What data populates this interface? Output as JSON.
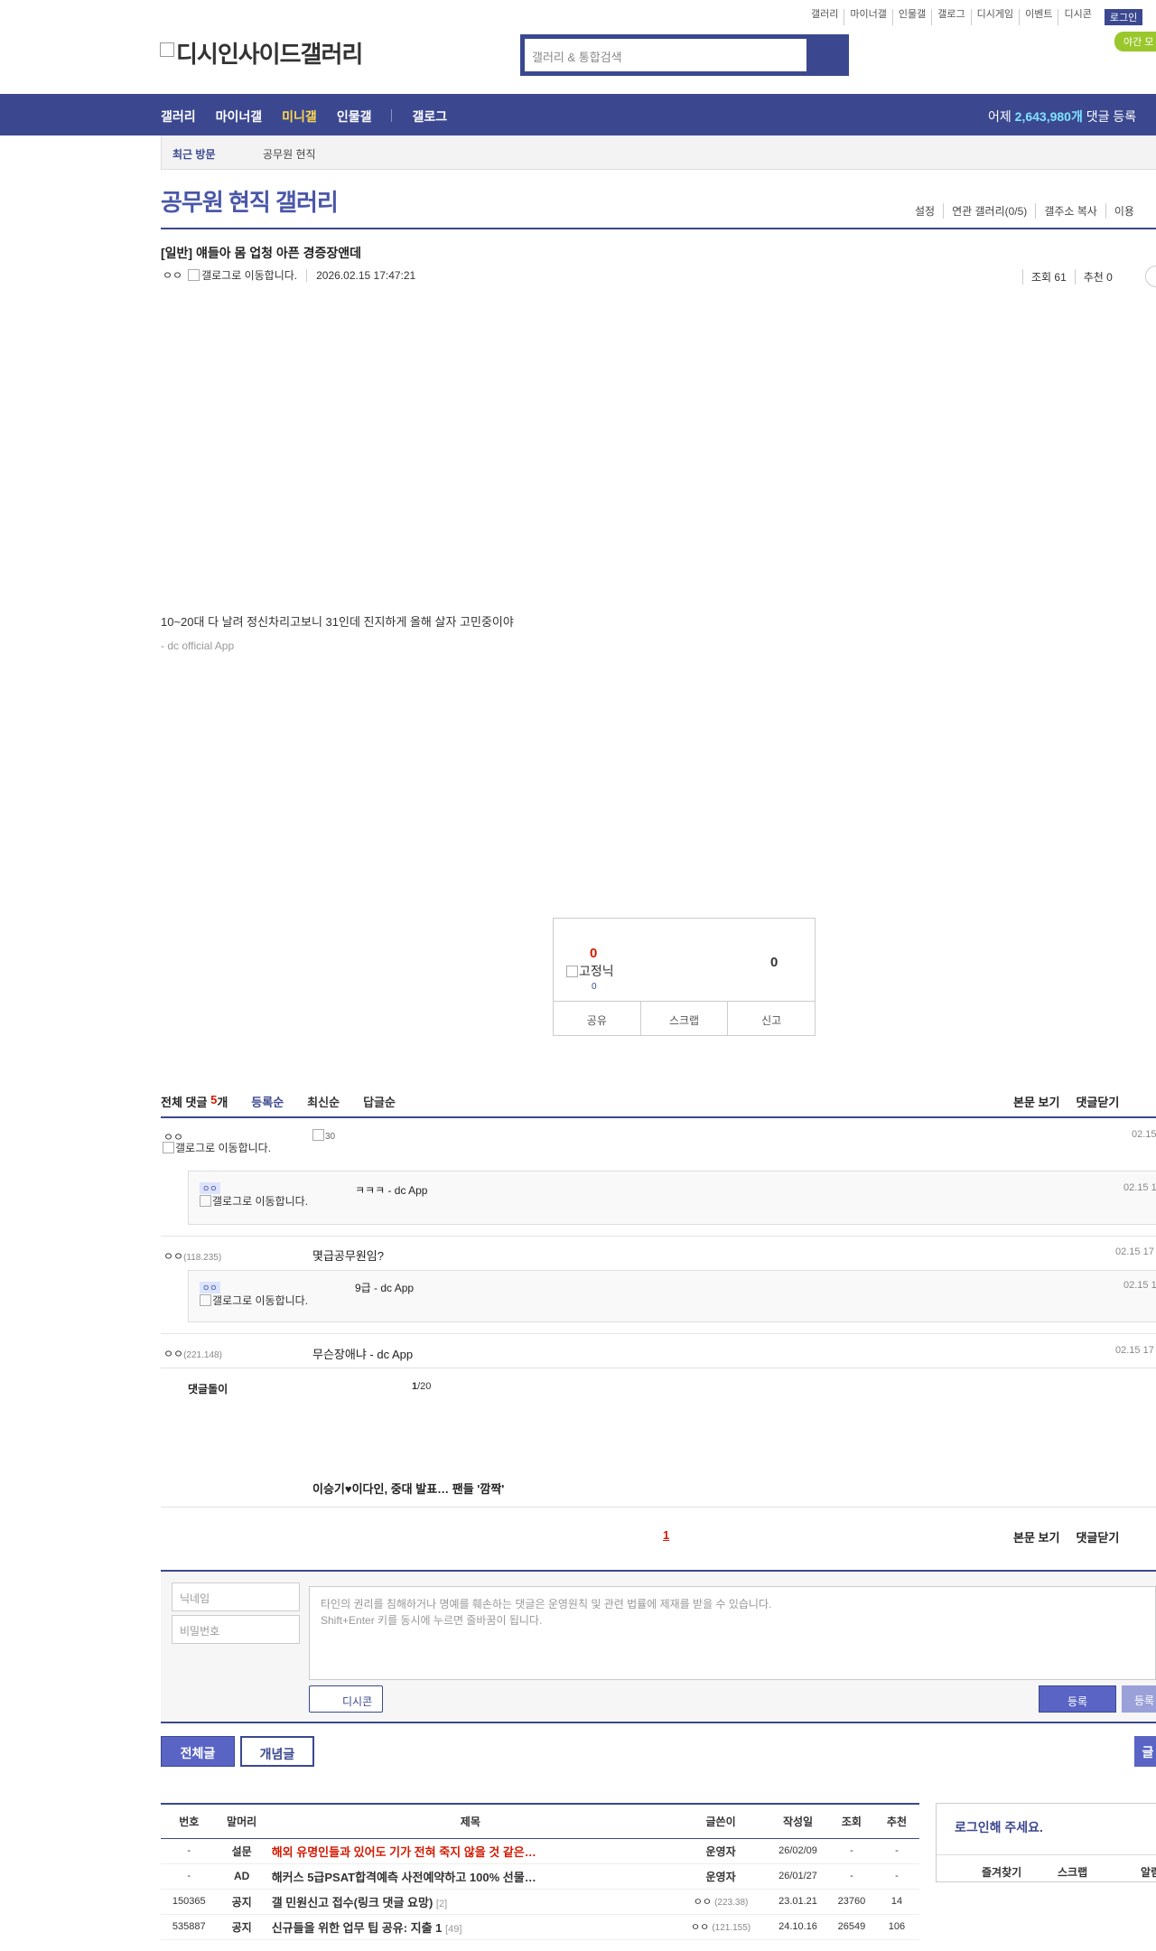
{
  "util_menu": [
    "갤러리",
    "마이너갤",
    "인물갤",
    "갤로그",
    "디시게임",
    "이벤트",
    "디시콘"
  ],
  "login_label": "로그인",
  "night_mode_label": "야간 모",
  "logo_text": "디시인사이드갤러리",
  "search": {
    "placeholder": "갤러리 & 통합검색"
  },
  "gnb": {
    "items": [
      "갤러리",
      "마이너갤",
      "미니갤",
      "인물갤",
      "갤로그"
    ],
    "stat_prefix": "어제",
    "stat_value": "2,643,980개",
    "stat_suffix": "댓글 등록"
  },
  "recent": {
    "label": "최근 방문",
    "gallery": "공무원 현직"
  },
  "gallery": {
    "title": "공무원 현직 갤러리",
    "options": [
      "설정",
      "연관 갤러리(0/5)",
      "갤주소 복사",
      "이용"
    ]
  },
  "post": {
    "title": "[일반] 얘들아 몸 업청 아픈 경증장앤데",
    "author": "ㅇㅇ",
    "author_img_alt": "갤로그로 이동합니다.",
    "date": "2026.02.15 17:47:21",
    "views": "조회 61",
    "recommends": "추천 0",
    "body": "10~20대 다 날려 정신차리고보니 31인데 진지하게 올해 살자 고민중이야",
    "app": "- dc official App"
  },
  "vote": {
    "up": "0",
    "fixed_label": "고정닉",
    "fixed_count": "0",
    "down": "0",
    "buttons": [
      "공유",
      "스크랩",
      "신고"
    ]
  },
  "comments_header": {
    "label": "전체 댓글",
    "count": "5",
    "unit": "개",
    "sorts": [
      "등록순",
      "최신순",
      "답글순"
    ],
    "right": [
      "본문 보기",
      "댓글닫기"
    ]
  },
  "comments": [
    {
      "nick": "ㅇㅇ",
      "img_alt": "갤로그로 이동합니다.",
      "img_text": "30",
      "date": "02.15"
    },
    {
      "nick": "ㅇㅇ",
      "img_alt": "갤로그로 이동합니다.",
      "text": "ㅋㅋㅋ - dc App",
      "date": "02.15 1"
    },
    {
      "nick": "ㅇㅇ",
      "ip": "(118.235)",
      "text": "몇급공무원임?",
      "date": "02.15 17"
    },
    {
      "nick": "ㅇㅇ",
      "img_alt": "갤로그로 이동합니다.",
      "text": "9급 - dc App",
      "date": "02.15 1"
    },
    {
      "nick": "ㅇㅇ",
      "ip": "(221.148)",
      "text": "무슨장애냐 - dc App",
      "date": "02.15 17"
    }
  ],
  "cmt_bot": {
    "label": "댓글돌이",
    "page": "1",
    "total": "/20"
  },
  "news": "이승기♥이다인, 중대 발표… 팬들 '깜짝'",
  "pager": "1",
  "write": {
    "nick_placeholder": "닉네임",
    "pw_placeholder": "비밀번호",
    "notice_line1": "타인의 권리를 침해하거나 명예를 훼손하는 댓글은 운영원칙 및 관련 법률에 제재를 받을 수 있습니다.",
    "notice_line2": "Shift+Enter 키를 동시에 누르면 줄바꿈이 됩니다.",
    "dccon": "디시콘",
    "submit": "등록",
    "submit2": "등록"
  },
  "list_buttons": {
    "all": "전체글",
    "concept": "개념글",
    "write": "글"
  },
  "table": {
    "headers": [
      "번호",
      "말머리",
      "제목",
      "글쓴이",
      "작성일",
      "조회",
      "추천"
    ],
    "rows": [
      {
        "no": "-",
        "head": "설문",
        "title": "해외 유명인들과 있어도 기가 전혀 죽지 않을 것 같은…",
        "rc": "",
        "writer": "운영자",
        "wip": "",
        "date": "26/02/09",
        "views": "-",
        "rec": "-",
        "red": true
      },
      {
        "no": "-",
        "head": "AD",
        "title": "해커스 5급PSAT합격예측 사전예약하고 100% 선물…",
        "rc": "",
        "writer": "운영자",
        "wip": "",
        "date": "26/01/27",
        "views": "-",
        "rec": "-",
        "red": false
      },
      {
        "no": "150365",
        "head": "공지",
        "title": "갤 민원신고 접수(링크 댓글 요망)",
        "rc": "[2]",
        "writer": "ㅇㅇ",
        "wip": "(223.38)",
        "date": "23.01.21",
        "views": "23760",
        "rec": "14",
        "red": false
      },
      {
        "no": "535887",
        "head": "공지",
        "title": "신규들을 위한 업무 팁 공유: 지출 1",
        "rc": "[49]",
        "writer": "ㅇㅇ",
        "wip": "(121.155)",
        "date": "24.10.16",
        "views": "26549",
        "rec": "106",
        "red": false
      }
    ]
  },
  "side_login": {
    "title": "로그인해 주세요.",
    "links": [
      "즐겨찾기",
      "스크랩",
      "알림"
    ]
  }
}
